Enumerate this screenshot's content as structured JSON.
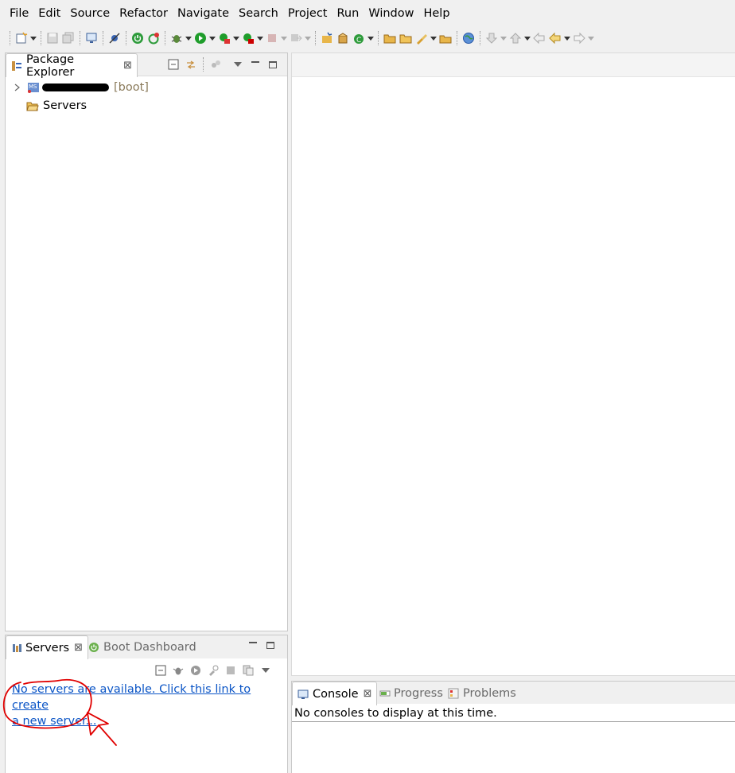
{
  "menu": [
    "File",
    "Edit",
    "Source",
    "Refactor",
    "Navigate",
    "Search",
    "Project",
    "Run",
    "Window",
    "Help"
  ],
  "package_explorer": {
    "tab_label": "Package Explorer",
    "close_glyph": "⊠",
    "project_suffix": "[boot]",
    "servers_item": "Servers"
  },
  "servers_view": {
    "tab_label": "Servers",
    "close_glyph": "⊠",
    "boot_dashboard_label": "Boot Dashboard",
    "empty_link_line1": "No servers are available. Click this link to create",
    "empty_link_line2": "a new server..."
  },
  "console_view": {
    "tab_label": "Console",
    "close_glyph": "⊠",
    "progress_label": "Progress",
    "problems_label": "Problems",
    "message": "No consoles to display at this time."
  },
  "colors": {
    "link": "#0b55c6",
    "annotation": "#e00000",
    "run_green": "#1f9d2b",
    "folder_yellow": "#e8b64a"
  }
}
